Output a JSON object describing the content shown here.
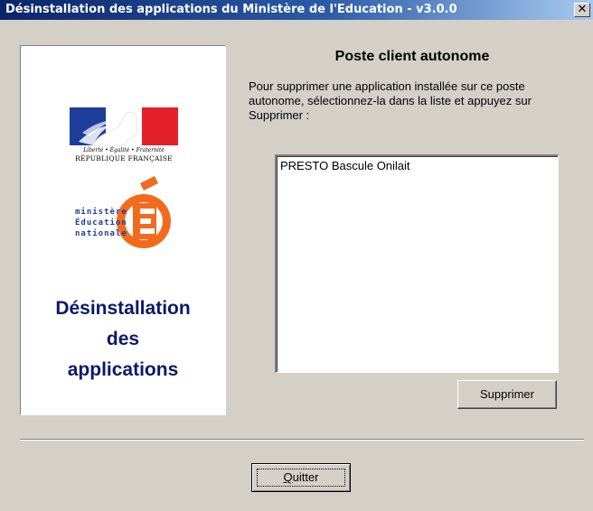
{
  "window": {
    "title": "Désinstallation des applications du Ministère de l'Education - v3.0.0",
    "close_glyph": "✕"
  },
  "left_panel": {
    "republic_motto": "Liberté • Égalité • Fraternité",
    "republic_name": "RÉPUBLIQUE FRANÇAISE",
    "ministry_lines": [
      "ministère",
      "Éducation",
      "nationale"
    ],
    "ministry_letter": "É",
    "title_lines": [
      "Désinstallation",
      "des",
      "applications"
    ]
  },
  "main": {
    "section_title": "Poste client autonome",
    "instructions": "Pour supprimer une application installée sur ce poste autonome, sélectionnez-la dans la liste et appuyez sur Supprimer :",
    "applications": [
      "PRESTO Bascule Onilait"
    ],
    "delete_button": "Supprimer",
    "quit_button": "Quitter"
  },
  "colors": {
    "titlebar_start": "#0a246a",
    "titlebar_end": "#a6caf0",
    "dialog_bg": "#d4d0c8",
    "left_title": "#0a1a6a",
    "flag_blue": "#1f3d9a",
    "flag_red": "#e4202a",
    "ministry_orange": "#f26b1d"
  }
}
